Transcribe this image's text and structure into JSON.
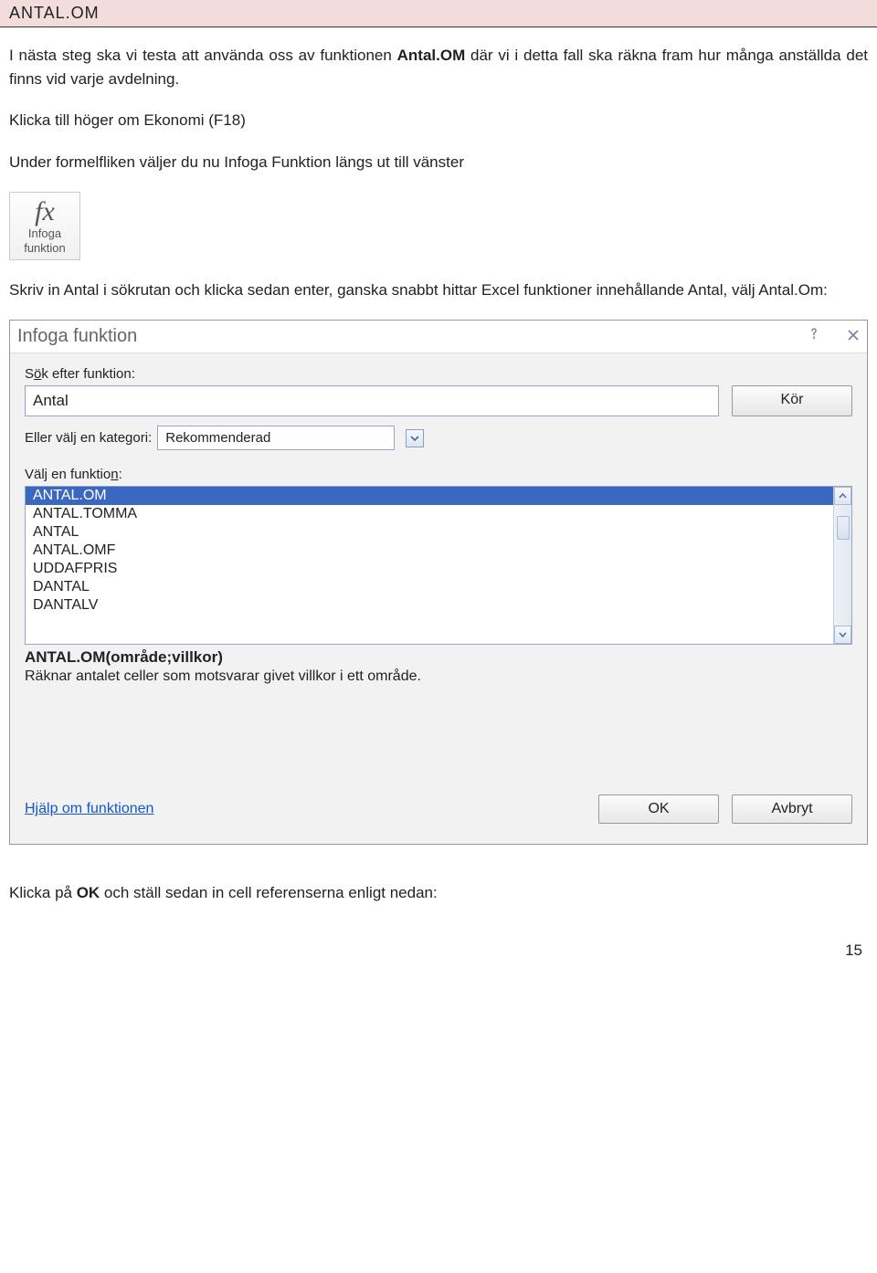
{
  "page": {
    "title_bar": "ANTAL.OM",
    "p1_a": "I nästa steg ska vi testa att använda oss av funktionen ",
    "p1_b": "Antal.OM",
    "p1_c": " där vi i detta fall ska räkna fram hur många anställda det finns vid varje avdelning.",
    "p2": "Klicka till höger om Ekonomi (F18)",
    "p3": "Under formelfliken väljer du nu Infoga Funktion längs ut till vänster",
    "fx_symbol": "fx",
    "fx_label1": "Infoga",
    "fx_label2": "funktion",
    "p4": "Skriv in Antal i sökrutan och klicka sedan enter, ganska snabbt hittar Excel funktioner innehållande Antal, välj Antal.Om:",
    "p5_a": "Klicka på ",
    "p5_b": "OK",
    "p5_c": " och ställ sedan in cell referenserna enligt nedan:",
    "page_number": "15"
  },
  "dialog": {
    "title": "Infoga funktion",
    "search_label_pre": "S",
    "search_label_ul": "ö",
    "search_label_post": "k efter funktion:",
    "search_value": "Antal",
    "run_btn": "Kör",
    "cat_label_pre": "Eller välj en ",
    "cat_label_ul": "k",
    "cat_label_post": "ategori:",
    "cat_value": "Rekommenderad",
    "select_func_pre": "Välj en funktio",
    "select_func_ul": "n",
    "select_func_post": ":",
    "functions": [
      "ANTAL.OM",
      "ANTAL.TOMMA",
      "ANTAL",
      "ANTAL.OMF",
      "UDDAFPRIS",
      "DANTAL",
      "DANTALV"
    ],
    "syntax": "ANTAL.OM(område;villkor)",
    "description": "Räknar antalet celler som motsvarar givet villkor i ett område.",
    "help_link": "Hjälp om funktionen",
    "ok_btn": "OK",
    "cancel_btn": "Avbryt"
  }
}
